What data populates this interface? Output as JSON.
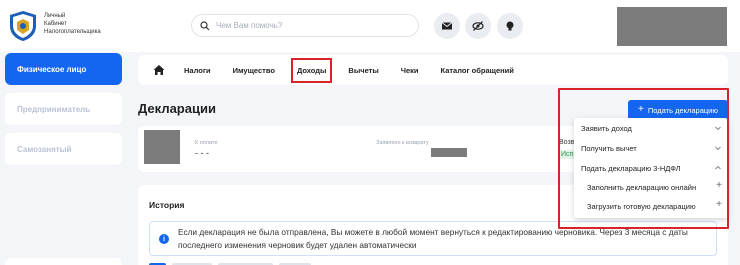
{
  "header": {
    "logo_lines": [
      "Личный",
      "Кабинет",
      "Налогоплательщика"
    ],
    "search_placeholder": "Чем Вам помочь?",
    "icons": [
      "mail-icon",
      "eye-off-icon",
      "lightbulb-icon"
    ]
  },
  "sidebar": {
    "items": [
      {
        "label": "Физическое лицо",
        "active": true
      },
      {
        "label": "Предприниматель",
        "active": false
      },
      {
        "label": "Самозанятый",
        "active": false
      }
    ]
  },
  "nav": {
    "items": [
      {
        "label": "Налоги"
      },
      {
        "label": "Имущество"
      },
      {
        "label": "Доходы",
        "selected": true
      },
      {
        "label": "Вычеты"
      },
      {
        "label": "Чеки"
      },
      {
        "label": "Каталог обращений"
      }
    ]
  },
  "main": {
    "title": "Декларации",
    "add_button_label": "Подать декларацию",
    "card": {
      "pay_label": "К оплате",
      "pay_value": "- - -",
      "refund_label": "Заявлено к возврату",
      "vozv_label": "Возвр",
      "status_label": "Исп"
    },
    "history": {
      "title": "История",
      "info_text": "Если декларация не была отправлена, Вы можете в любой момент вернуться к редактированию черновика. Через 3 месяца с даты последнего изменения черновик будет удален автоматически"
    }
  },
  "dropdown": {
    "items": [
      {
        "label": "Заявить доход"
      },
      {
        "label": "Получить вычет"
      },
      {
        "label": "Подать декларацию 3-НДФЛ"
      },
      {
        "label": "Заполнить декларацию онлайн"
      },
      {
        "label": "Загрузить готовую декларацию"
      }
    ]
  },
  "colors": {
    "accent": "#1466f0",
    "highlight": "#d8232a",
    "status_green": "#2a9a48"
  }
}
